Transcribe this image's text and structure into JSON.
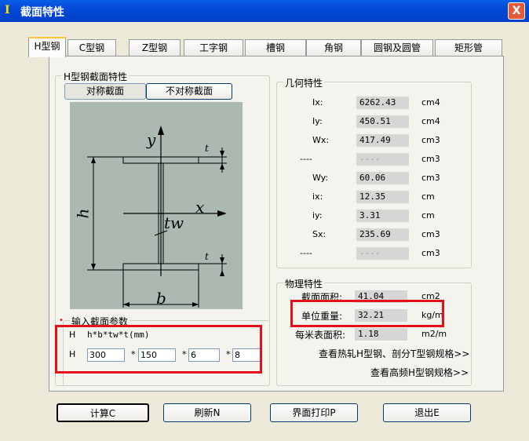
{
  "window": {
    "title": "截面特性",
    "close_label": "X"
  },
  "tabs": [
    "H型钢",
    "C型钢",
    "Z型钢",
    "工字钢",
    "槽钢",
    "角钢",
    "圆钢及圆管",
    "矩形管"
  ],
  "h_section": {
    "group_title": "H型钢截面特性",
    "sym_button": "对称截面",
    "asym_button": "不对称截面",
    "drawing_labels": {
      "y": "y",
      "x": "x",
      "h": "h",
      "tw": "tw",
      "b": "b",
      "t1": "t",
      "t2": "t"
    }
  },
  "input_params": {
    "group_title": "输入截面参数",
    "format_prefix": "H",
    "format_text": "h*b*tw*t(mm)",
    "row_prefix": "H",
    "h": "300",
    "b": "150",
    "tw": "6",
    "t": "8",
    "sep": "*"
  },
  "geometry": {
    "group_title": "几何特性",
    "rows": [
      {
        "label": "Ix:",
        "value": "6262.43",
        "unit": "cm4"
      },
      {
        "label": "Iy:",
        "value": "450.51",
        "unit": "cm4"
      },
      {
        "label": "Wx:",
        "value": "417.49",
        "unit": "cm3"
      },
      {
        "label": "----",
        "value": "----",
        "unit": "cm3"
      },
      {
        "label": "Wy:",
        "value": "60.06",
        "unit": "cm3"
      },
      {
        "label": "ix:",
        "value": "12.35",
        "unit": "cm"
      },
      {
        "label": "iy:",
        "value": "3.31",
        "unit": "cm"
      },
      {
        "label": "Sx:",
        "value": "235.69",
        "unit": "cm3"
      },
      {
        "label": "----",
        "value": "----",
        "unit": "cm3"
      }
    ]
  },
  "physical": {
    "group_title": "物理特性",
    "area_label": "截面面积:",
    "area_value": "41.04",
    "area_unit": "cm2",
    "weight_label": "单位重量:",
    "weight_value": "32.21",
    "weight_unit": "kg/m",
    "surface_label": "每米表面积:",
    "surface_value": "1.18",
    "surface_unit": "m2/m",
    "link1": "查看热轧H型钢、剖分T型钢规格>>",
    "link2": "查看高频H型钢规格>>"
  },
  "buttons": {
    "calc": "计算C",
    "refresh": "刷新N",
    "print": "界面打印P",
    "exit": "退出E"
  }
}
